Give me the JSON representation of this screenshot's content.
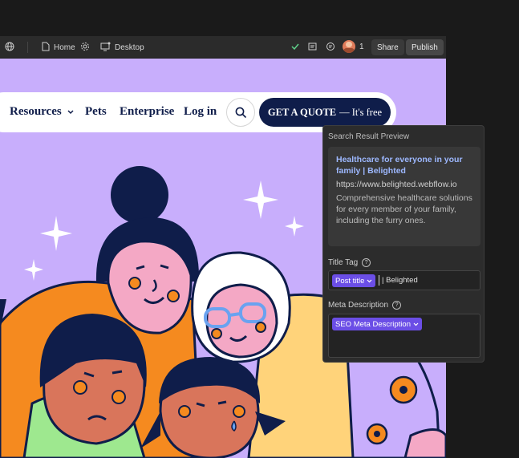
{
  "toolbar": {
    "page_label": "Home",
    "breakpoint_label": "Desktop",
    "collaborator_count": "1",
    "share_label": "Share",
    "publish_label": "Publish"
  },
  "site_nav": {
    "links": [
      "Resources",
      "Pets",
      "Enterprise",
      "Log in"
    ],
    "cta_bold": "GET A QUOTE",
    "cta_rest": "— It's free"
  },
  "seo_panel": {
    "title": "Search Result Preview",
    "preview": {
      "title": "Healthcare for everyone in your family | Belighted",
      "url": "https://www.belighted.webflow.io",
      "description": "Comprehensive healthcare solutions for every member of your family, including the furry ones."
    },
    "title_tag": {
      "label": "Title Tag",
      "token": "Post title",
      "suffix": "| Belighted"
    },
    "meta_description": {
      "label": "Meta Description",
      "token": "SEO Meta Description"
    }
  },
  "colors": {
    "canvas_bg": "#c8aefc",
    "brand_navy": "#0f1d4a",
    "token_purple": "#6b4ee6",
    "accent_orange": "#f58a1f",
    "skin_pink": "#f4a8c5"
  }
}
